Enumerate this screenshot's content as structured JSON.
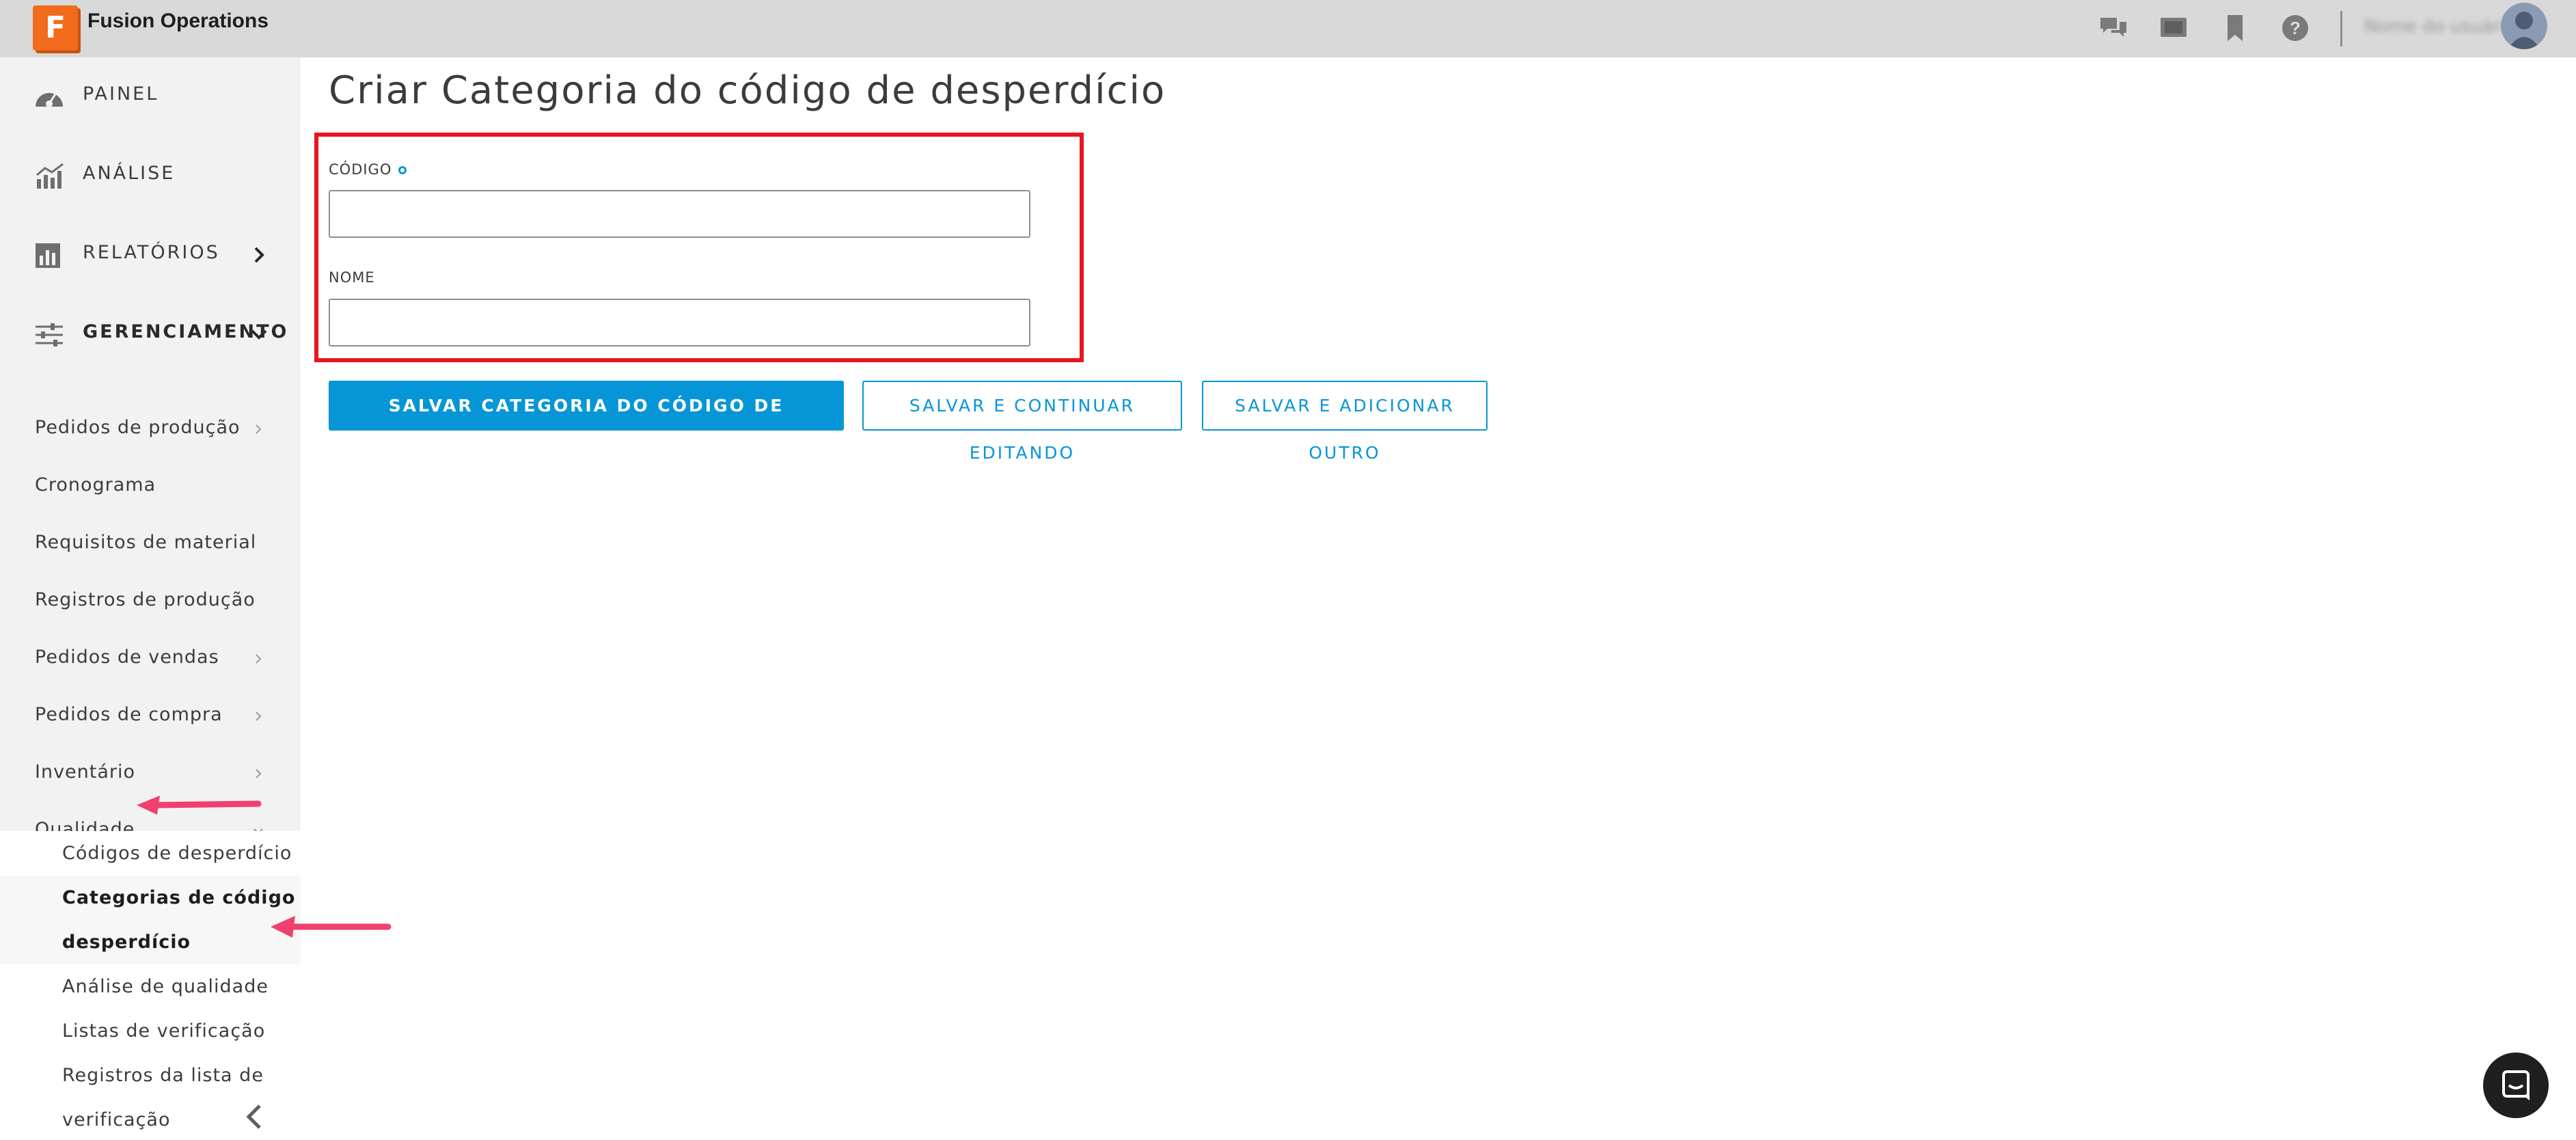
{
  "app": {
    "logo_letter": "F",
    "name": "Fusion Operations",
    "user_name": "Nome do usuário"
  },
  "topbar": {
    "icons": [
      "chat-icon",
      "monitor-icon",
      "bookmark-icon",
      "help-icon"
    ]
  },
  "sidebar": {
    "main_items": [
      {
        "label": "PAINEL",
        "icon": "dashboard-gauge-icon"
      },
      {
        "label": "ANÁLISE",
        "icon": "analytics-chart-icon"
      },
      {
        "label": "RELATÓRIOS",
        "icon": "reports-icon",
        "chevron": "right"
      },
      {
        "label": "GERENCIAMENTO",
        "icon": "sliders-icon",
        "chevron": "down"
      }
    ],
    "sub_items": [
      {
        "label": "Pedidos de produção",
        "chevron": true
      },
      {
        "label": "Cronograma",
        "chevron": false
      },
      {
        "label": "Requisitos de material",
        "chevron": false
      },
      {
        "label": "Registros de produção",
        "chevron": false
      },
      {
        "label": "Pedidos de vendas",
        "chevron": true
      },
      {
        "label": "Pedidos de compra",
        "chevron": true
      },
      {
        "label": "Inventário",
        "chevron": true
      },
      {
        "label": "Qualidade",
        "chevron": true
      }
    ],
    "quality_children": [
      {
        "label_lines": [
          "Códigos de desperdício"
        ]
      },
      {
        "label_lines": [
          "Categorias de código de",
          "desperdício"
        ],
        "active": true
      },
      {
        "label_lines": [
          "Análise de qualidade"
        ]
      },
      {
        "label_lines": [
          "Listas de verificação"
        ]
      },
      {
        "label_lines": [
          "Registros da lista de",
          "verificação"
        ]
      }
    ]
  },
  "main": {
    "title": "Criar Categoria do código de desperdício",
    "fields": [
      {
        "label": "CÓDIGO",
        "required": true,
        "value": "",
        "placeholder": ""
      },
      {
        "label": "NOME",
        "required": false,
        "value": "",
        "placeholder": ""
      }
    ],
    "buttons": {
      "save": "SALVAR CATEGORIA DO CÓDIGO DE DESPERDÍCIO",
      "save_continue": "SALVAR E CONTINUAR EDITANDO",
      "save_add": "SALVAR E ADICIONAR OUTRO"
    }
  },
  "colors": {
    "accent": "#0696d7",
    "highlight": "#e8161e",
    "annotation_arrow": "#f0416e",
    "logo": "#f26a1b"
  }
}
